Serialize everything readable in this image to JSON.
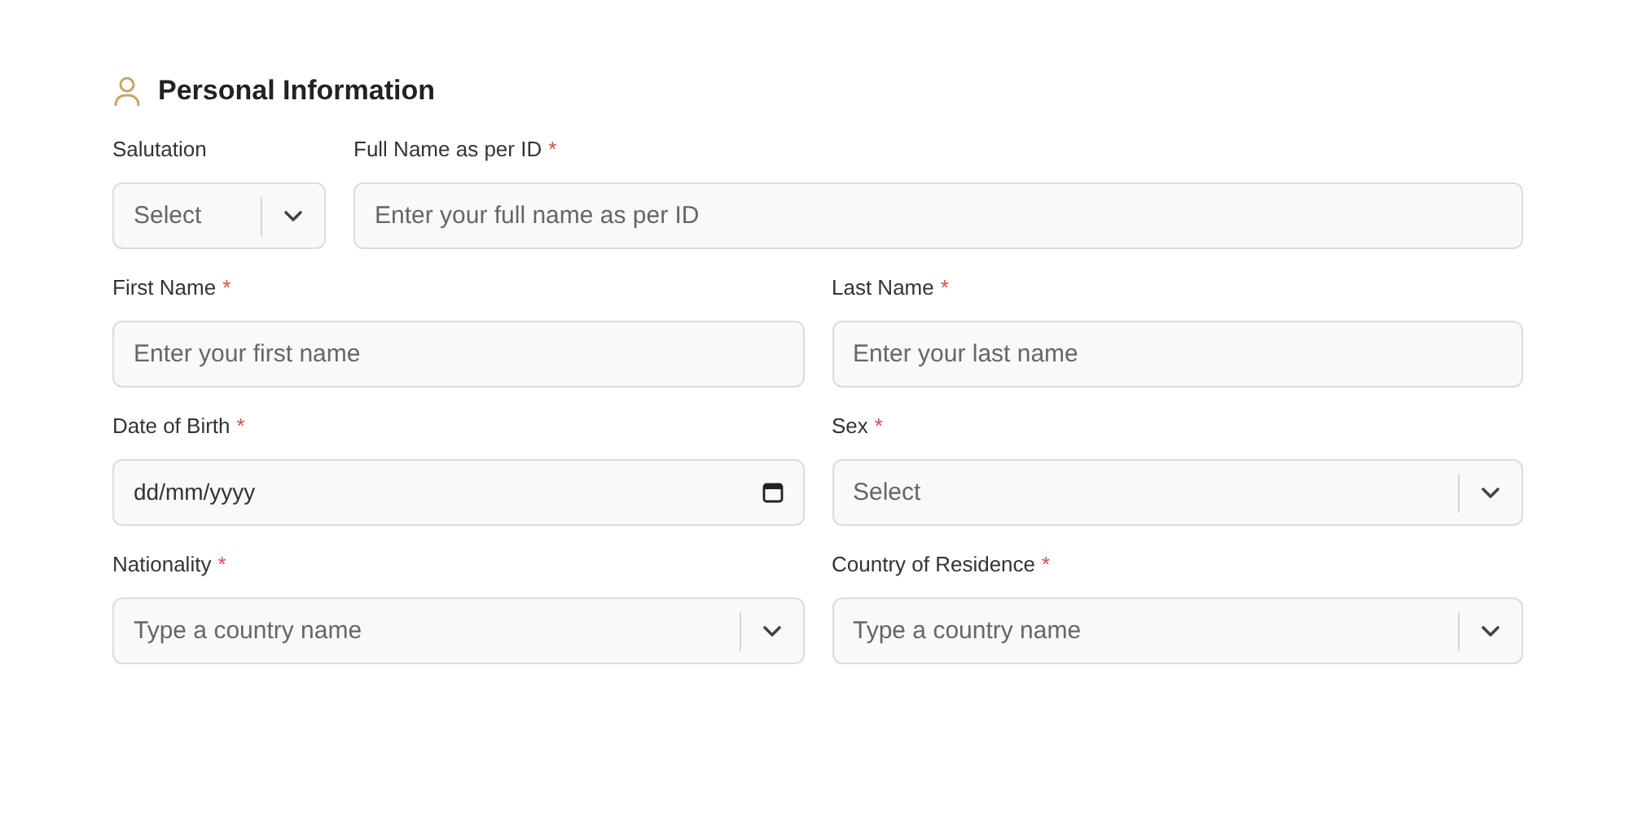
{
  "section": {
    "title": "Personal Information"
  },
  "rows": [
    [
      {
        "label": "Salutation",
        "kind": "select",
        "placeholder": "Select"
      },
      {
        "label": "Full Name as per ID",
        "required_mark": "*",
        "kind": "text",
        "placeholder": "Enter your full name as per ID"
      }
    ],
    [
      {
        "label": "First Name",
        "required_mark": "*",
        "kind": "text",
        "placeholder": "Enter your first name"
      },
      {
        "label": "Last Name",
        "required_mark": "*",
        "kind": "text",
        "placeholder": "Enter your last name"
      }
    ],
    [
      {
        "label": "Date of Birth",
        "required_mark": "*",
        "kind": "date",
        "placeholder": "dd/mm/yyyy"
      },
      {
        "label": "Sex",
        "required_mark": "*",
        "kind": "select",
        "placeholder": "Select"
      }
    ],
    [
      {
        "label": "Nationality",
        "required_mark": "*",
        "kind": "select",
        "placeholder": "Type a country name"
      },
      {
        "label": "Country of Residence",
        "required_mark": "*",
        "kind": "select",
        "placeholder": "Type a country name"
      }
    ]
  ]
}
